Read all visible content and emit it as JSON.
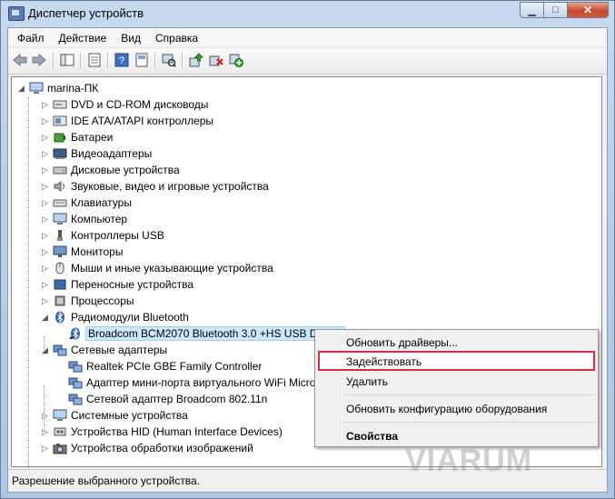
{
  "window": {
    "title": "Диспетчер устройств",
    "minimize_glyph": "▁",
    "maximize_glyph": "□",
    "close_glyph": "✕"
  },
  "menu": [
    "Файл",
    "Действие",
    "Вид",
    "Справка"
  ],
  "toolbar": {
    "icons": [
      "back-icon",
      "forward-icon",
      "console-tree-icon",
      "properties-icon",
      "help-icon",
      "show-hide-icon",
      "scan-hardware-icon",
      "update-driver-icon",
      "uninstall-icon",
      "enable-icon"
    ]
  },
  "tree": {
    "root": "marina-ПК",
    "categories": [
      {
        "label": "DVD и CD-ROM дисководы",
        "icon": "dvd-drive-icon"
      },
      {
        "label": "IDE ATA/ATAPI контроллеры",
        "icon": "ide-controller-icon"
      },
      {
        "label": "Батареи",
        "icon": "battery-icon"
      },
      {
        "label": "Видеоадаптеры",
        "icon": "display-adapter-icon"
      },
      {
        "label": "Дисковые устройства",
        "icon": "disk-drive-icon"
      },
      {
        "label": "Звуковые, видео и игровые устройства",
        "icon": "sound-icon"
      },
      {
        "label": "Клавиатуры",
        "icon": "keyboard-icon"
      },
      {
        "label": "Компьютер",
        "icon": "computer-icon"
      },
      {
        "label": "Контроллеры USB",
        "icon": "usb-icon"
      },
      {
        "label": "Мониторы",
        "icon": "monitor-icon"
      },
      {
        "label": "Мыши и иные указывающие устройства",
        "icon": "mouse-icon"
      },
      {
        "label": "Переносные устройства",
        "icon": "portable-device-icon"
      },
      {
        "label": "Процессоры",
        "icon": "processor-icon"
      },
      {
        "label": "Радиомодули Bluetooth",
        "icon": "bluetooth-icon"
      },
      {
        "label": "Сетевые адаптеры",
        "icon": "network-adapter-icon"
      },
      {
        "label": "Системные устройства",
        "icon": "system-device-icon"
      },
      {
        "label": "Устройства HID (Human Interface Devices)",
        "icon": "hid-icon"
      },
      {
        "label": "Устройства обработки изображений",
        "icon": "imaging-device-icon"
      }
    ],
    "bluetooth_children": [
      "Broadcom BCM2070 Bluetooth 3.0 +HS USB Device"
    ],
    "network_children": [
      "Realtek PCIe GBE Family Controller",
      "Адаптер мини-порта виртуального WiFi Micro",
      "Сетевой адаптер Broadcom 802.11n"
    ]
  },
  "context_menu": {
    "items": [
      "Обновить драйверы...",
      "Задействовать",
      "Удалить",
      "Обновить конфигурацию оборудования",
      "Свойства"
    ]
  },
  "status": "Разрешение выбранного устройства.",
  "watermark": "VIARUM",
  "colors": {
    "selection": "#cce8ff",
    "highlight_border": "#d0304c"
  }
}
